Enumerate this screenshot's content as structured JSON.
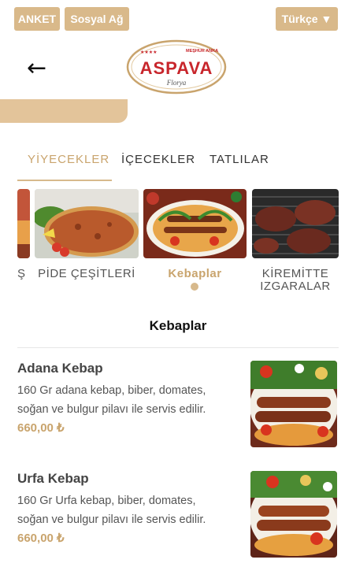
{
  "topbar": {
    "anket_label": "ANKET",
    "sosyal_label": "Sosyal Ağ",
    "language_label": "Türkçe ▼"
  },
  "header": {
    "back_symbol": "←",
    "logo": {
      "brand": "ASPAVA",
      "tagline": "MEŞHUR ANKA",
      "subtitle": "Florya"
    }
  },
  "tabs": [
    {
      "label": "YİYECEKLER",
      "active": true
    },
    {
      "label": "İÇECEKLER",
      "active": false
    },
    {
      "label": "TATLILAR",
      "active": false
    }
  ],
  "categories": [
    {
      "label": "Ş",
      "active": false
    },
    {
      "label": "PİDE ÇEŞİTLERİ",
      "active": false
    },
    {
      "label": "Kebaplar",
      "active": true
    },
    {
      "label": "KİREMİTTE IZGARALAR",
      "active": false
    }
  ],
  "section": {
    "title": "Kebaplar"
  },
  "items": [
    {
      "name": "Adana Kebap",
      "description": "160 Gr adana kebap, biber, domates, soğan ve bulgur pilavı ile servis edilir.",
      "price": "660,00 ₺"
    },
    {
      "name": "Urfa Kebap",
      "description": "160 Gr  Urfa  kebap, biber, domates, soğan ve bulgur pilavı ile servis edilir.",
      "price": "660,00 ₺"
    }
  ],
  "colors": {
    "accent": "#d9b98a",
    "accent_text": "#c9a46d",
    "logo_red": "#c8262c"
  }
}
